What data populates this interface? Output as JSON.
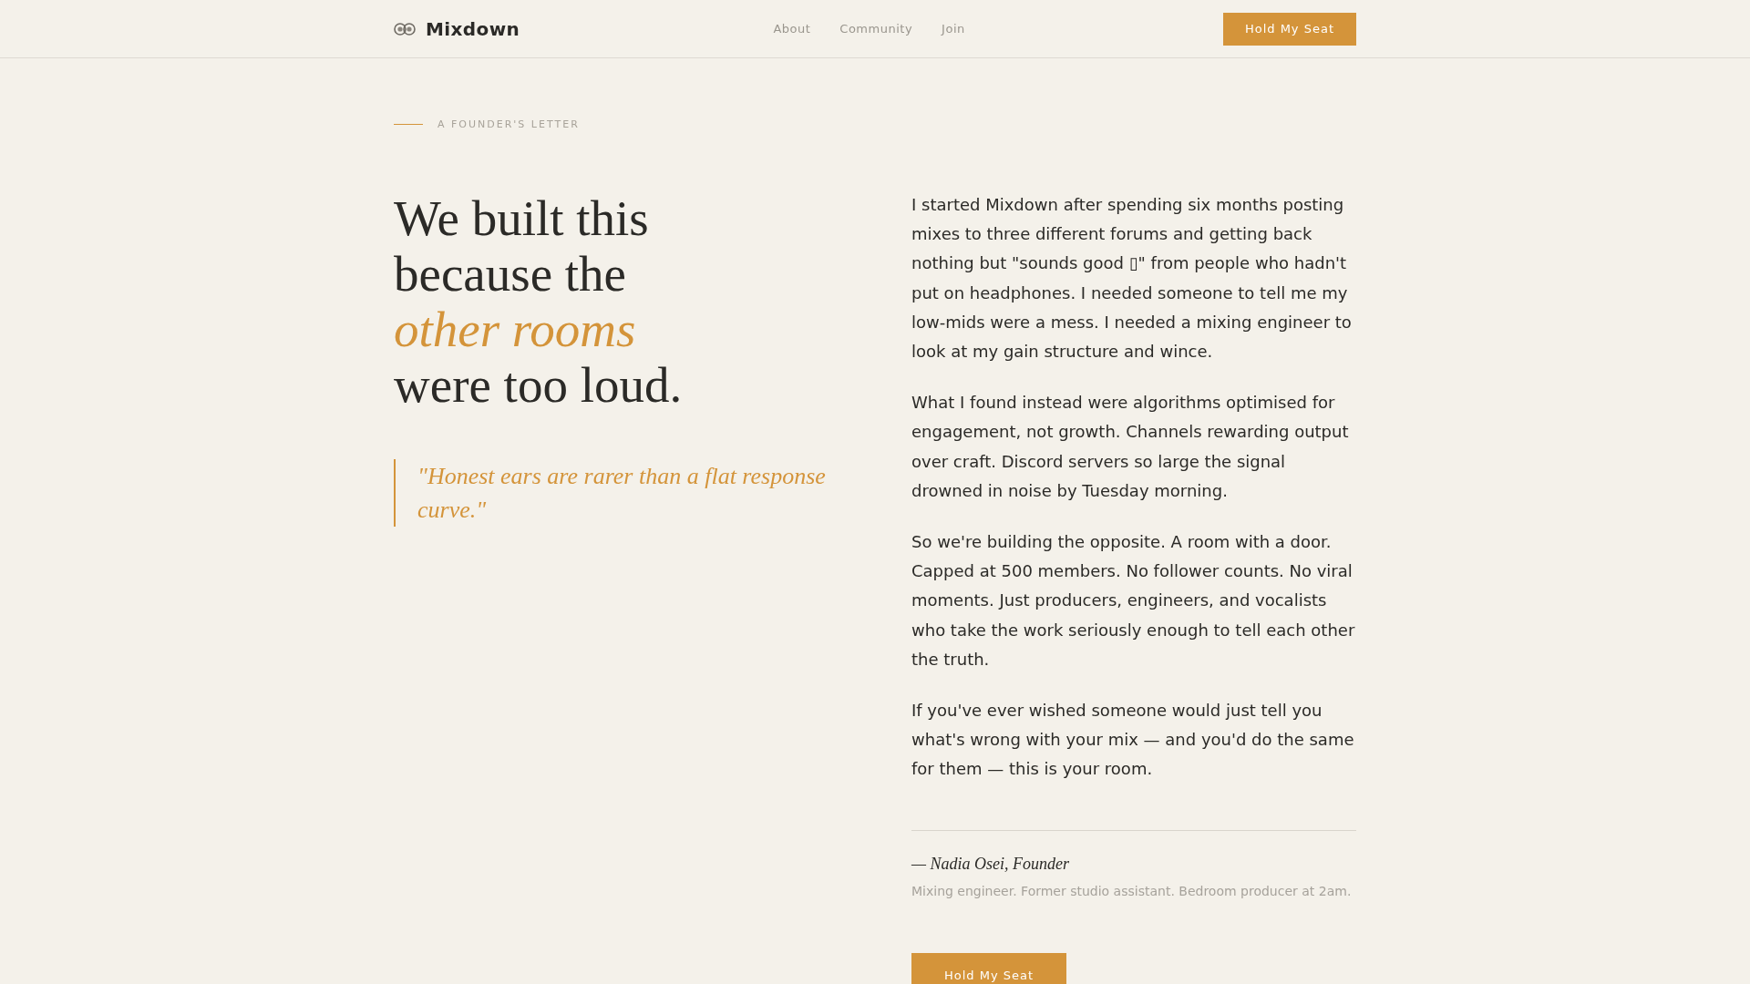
{
  "header": {
    "logo": {
      "name": "Mixdown"
    },
    "nav": [
      {
        "label": "About"
      },
      {
        "label": "Community"
      },
      {
        "label": "Join"
      }
    ],
    "cta": "Hold My Seat"
  },
  "eyebrow": "A FOUNDER'S LETTER",
  "headline": "We built this because the *other rooms* were too loud.",
  "quote": "\"Honest ears are rarer than a flat response curve.\"",
  "letter": {
    "paragraphs": [
      "I started Mixdown after spending six months posting mixes to three different forums and getting back nothing but \"sounds good ▯\" from people who hadn't put on headphones. I needed someone to tell me my low-mids were a mess. I needed a mixing engineer to look at my gain structure and wince.",
      "What I found instead were algorithms optimised for engagement, not growth. Channels rewarding output over craft. Discord servers so large the signal drowned in noise by Tuesday morning.",
      "So we're building the opposite. A room with a door. Capped at 500 members. No follower counts. No viral moments. Just producers, engineers, and vocalists who take the work seriously enough to tell each other the truth.",
      "If you've ever wished someone would just tell you what's wrong with your mix — and you'd do the same for them — this is your room."
    ]
  },
  "signature": {
    "name": "— Nadia Osei, Founder",
    "bio": "Mixing engineer. Former studio assistant. Bedroom producer at 2am."
  },
  "cta": "Hold My Seat"
}
